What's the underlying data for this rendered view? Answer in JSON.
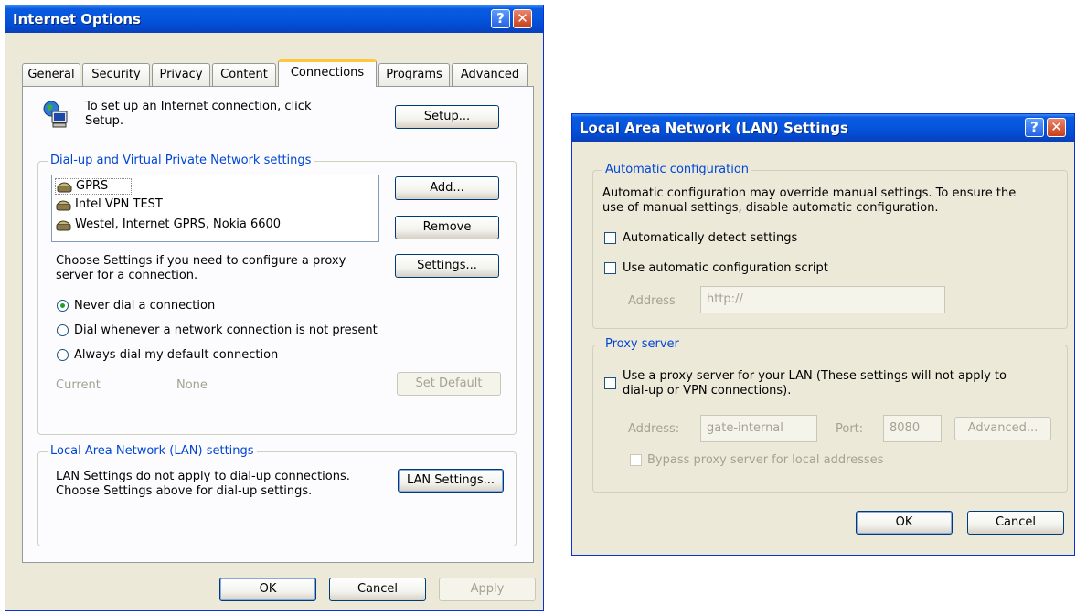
{
  "internet_options": {
    "title": "Internet Options",
    "help_glyph": "?",
    "close_glyph": "✕",
    "tabs": [
      "General",
      "Security",
      "Privacy",
      "Content",
      "Connections",
      "Programs",
      "Advanced"
    ],
    "active_tab": "Connections",
    "setup_text_line1": "To set up an Internet connection, click",
    "setup_text_line2": "Setup.",
    "setup_button": "Setup...",
    "dialup_group_label": "Dial-up and Virtual Private Network settings",
    "connections": [
      "GPRS",
      "Intel VPN TEST",
      "Westel, Internet GPRS, Nokia 6600"
    ],
    "add_button": "Add...",
    "remove_button": "Remove",
    "settings_text_line1": "Choose Settings if you need to configure a proxy",
    "settings_text_line2": "server for a connection.",
    "settings_button": "Settings...",
    "radio_options": [
      "Never dial a connection",
      "Dial whenever a network connection is not present",
      "Always dial my default connection"
    ],
    "selected_radio": 0,
    "current_label": "Current",
    "current_value": "None",
    "set_default_button": "Set Default",
    "lan_group_label": "Local Area Network (LAN) settings",
    "lan_text_line1": "LAN Settings do not apply to dial-up connections.",
    "lan_text_line2": "Choose Settings above for dial-up settings.",
    "lan_settings_button": "LAN Settings...",
    "ok_button": "OK",
    "cancel_button": "Cancel",
    "apply_button": "Apply"
  },
  "lan_settings": {
    "title": "Local Area Network (LAN) Settings",
    "help_glyph": "?",
    "close_glyph": "✕",
    "auto_group_label": "Automatic configuration",
    "auto_text_line1": "Automatic configuration may override manual settings.  To ensure the",
    "auto_text_line2": "use of manual settings, disable automatic configuration.",
    "auto_detect_label": "Automatically detect settings",
    "auto_script_label": "Use automatic configuration script",
    "address_label": "Address",
    "address_value": "http://",
    "proxy_group_label": "Proxy server",
    "proxy_label_line1": "Use a proxy server for your LAN (These settings will not apply to",
    "proxy_label_line2": "dial-up or VPN connections).",
    "proxy_address_label": "Address:",
    "proxy_address_value": "gate-internal",
    "port_label": "Port:",
    "port_value": "8080",
    "advanced_button": "Advanced...",
    "bypass_label": "Bypass proxy server for local addresses",
    "ok_button": "OK",
    "cancel_button": "Cancel"
  },
  "colors": {
    "titlebar_blue": "#0556de",
    "dialog_face": "#ece9d8",
    "group_label_blue": "#0046d5",
    "active_tab_accent": "#ffc83c"
  }
}
